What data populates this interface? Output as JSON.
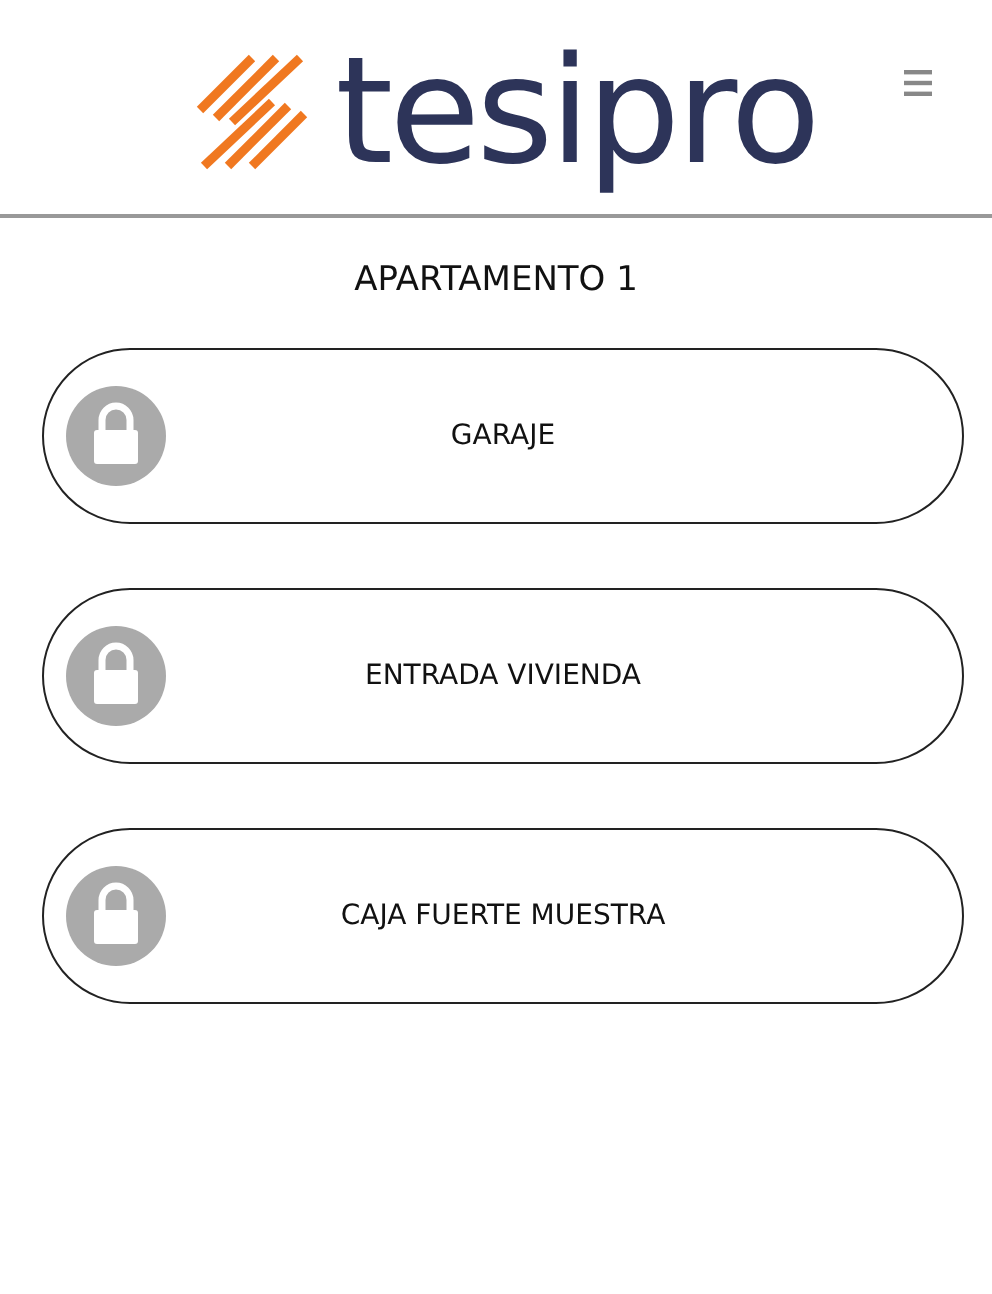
{
  "header": {
    "logo_text": "tesipro"
  },
  "title": "APARTAMENTO 1",
  "doors": [
    {
      "label": "GARAJE"
    },
    {
      "label": "ENTRADA VIVIENDA"
    },
    {
      "label": "CAJA FUERTE MUESTRA"
    }
  ]
}
